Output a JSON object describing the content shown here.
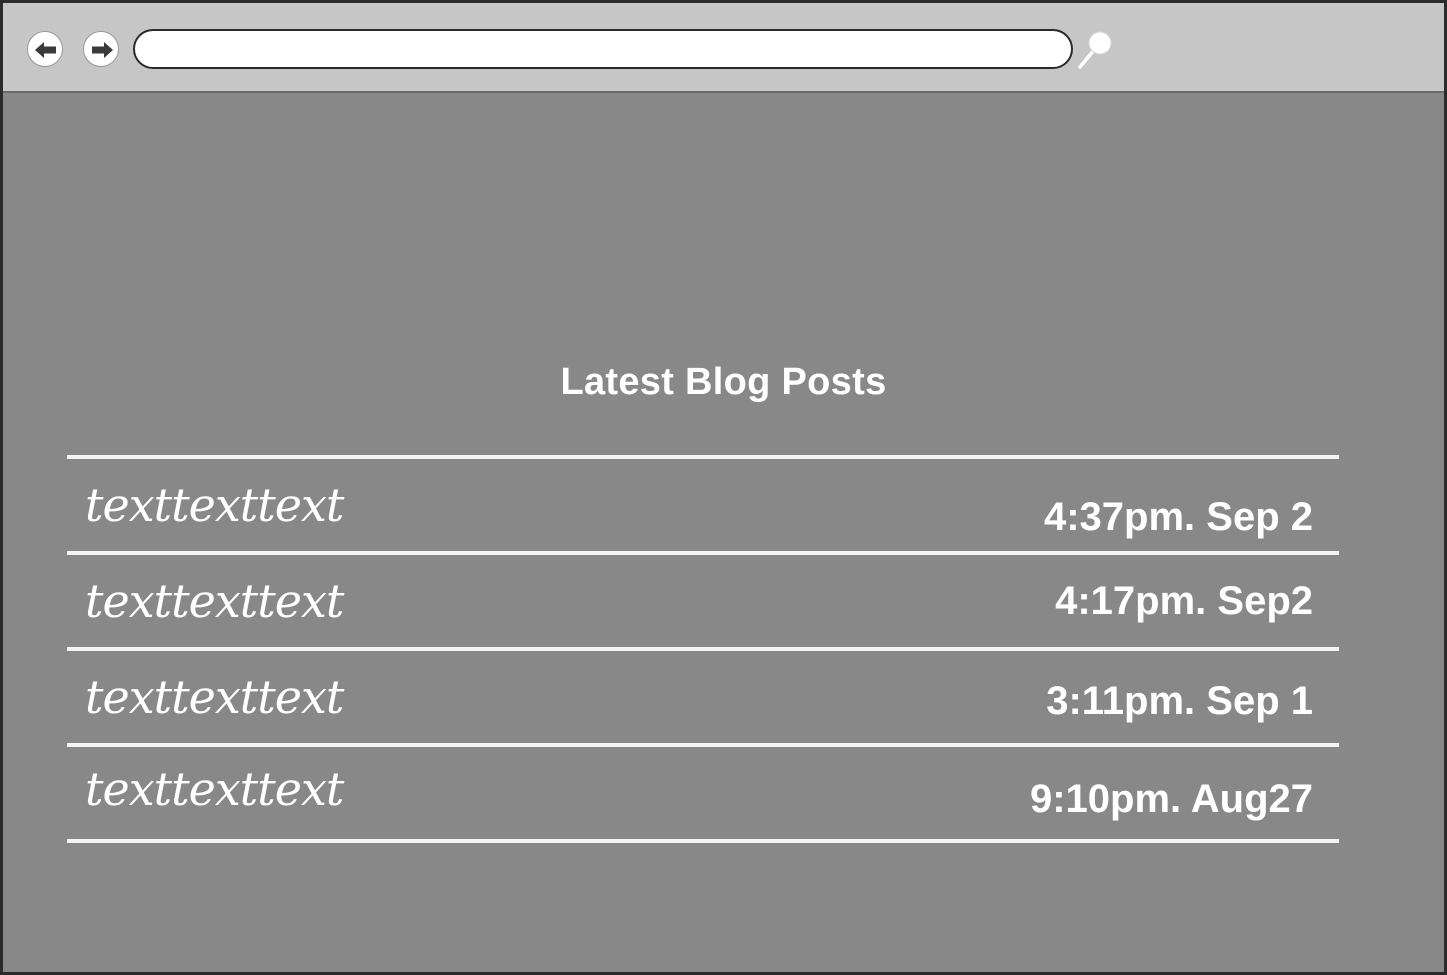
{
  "browser": {
    "address": "",
    "icons": {
      "back": "arrow-left-icon",
      "forward": "arrow-right-icon",
      "search": "magnifier-icon"
    }
  },
  "blog": {
    "title": "Latest Blog Posts",
    "posts": [
      {
        "title": "texttexttext",
        "date": "4:37pm. Sep 2"
      },
      {
        "title": "texttexttext",
        "date": "4:17pm. Sep2"
      },
      {
        "title": "texttexttext",
        "date": "3:11pm. Sep 1"
      },
      {
        "title": "texttexttext",
        "date": "9:10pm. Aug27"
      }
    ]
  },
  "colors": {
    "page_background": "#888888",
    "toolbar_background": "#c6c6c6",
    "text": "#ffffff",
    "divider": "#f4f4f4"
  }
}
